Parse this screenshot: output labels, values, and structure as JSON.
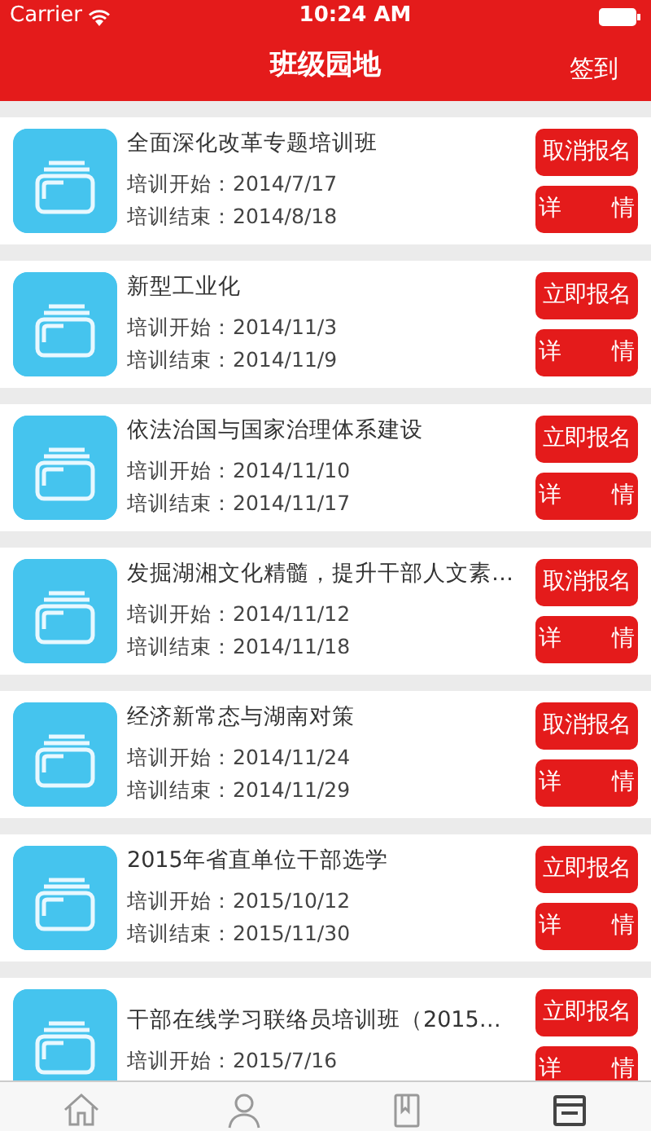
{
  "status_bar": {
    "carrier": "Carrier",
    "time": "10:24 AM"
  },
  "nav_bar": {
    "title": "班级园地",
    "action": "签到"
  },
  "courses": [
    {
      "title": "全面深化改革专题培训班",
      "start_label": "培训开始：",
      "start": "2014/7/17",
      "end_label": "培训结束：",
      "end": "2014/8/18",
      "action": "取消报名",
      "details": "详情"
    },
    {
      "title": "新型工业化",
      "start_label": "培训开始：",
      "start": "2014/11/3",
      "end_label": "培训结束：",
      "end": "2014/11/9",
      "action": "立即报名",
      "details": "详情"
    },
    {
      "title": "依法治国与国家治理体系建设",
      "start_label": "培训开始：",
      "start": "2014/11/10",
      "end_label": "培训结束：",
      "end": "2014/11/17",
      "action": "立即报名",
      "details": "详情"
    },
    {
      "title": "发掘湖湘文化精髓，提升干部人文素…",
      "start_label": "培训开始：",
      "start": "2014/11/12",
      "end_label": "培训结束：",
      "end": "2014/11/18",
      "action": "取消报名",
      "details": "详情"
    },
    {
      "title": "经济新常态与湖南对策",
      "start_label": "培训开始：",
      "start": "2014/11/24",
      "end_label": "培训结束：",
      "end": "2014/11/29",
      "action": "取消报名",
      "details": "详情"
    },
    {
      "title": "2015年省直单位干部选学",
      "start_label": "培训开始：",
      "start": "2015/10/12",
      "end_label": "培训结束：",
      "end": "2015/11/30",
      "action": "立即报名",
      "details": "详情"
    },
    {
      "title": "干部在线学习联络员培训班（2015…",
      "start_label": "培训开始：",
      "start": "2015/7/16",
      "action": "立即报名",
      "details": "详情"
    }
  ],
  "tab_bar": [
    {
      "kind": "home",
      "selected": false
    },
    {
      "kind": "person",
      "selected": false
    },
    {
      "kind": "book",
      "selected": false
    },
    {
      "kind": "list",
      "selected": true
    }
  ]
}
